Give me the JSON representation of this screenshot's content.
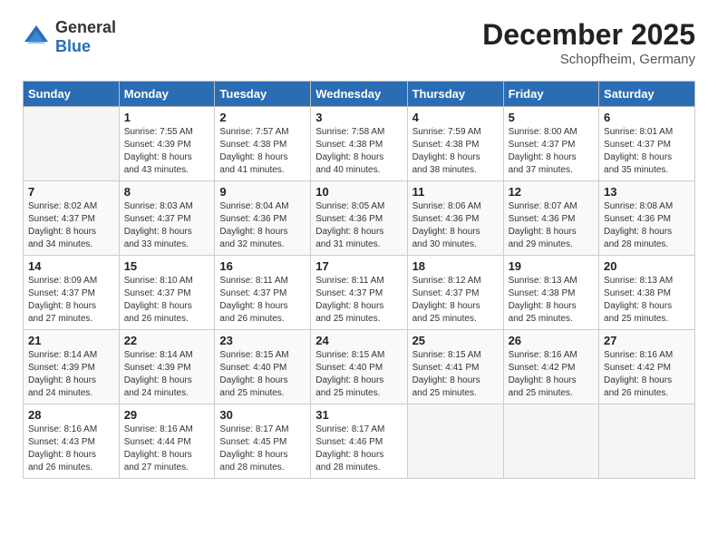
{
  "header": {
    "logo_general": "General",
    "logo_blue": "Blue",
    "month_title": "December 2025",
    "subtitle": "Schopfheim, Germany"
  },
  "days_of_week": [
    "Sunday",
    "Monday",
    "Tuesday",
    "Wednesday",
    "Thursday",
    "Friday",
    "Saturday"
  ],
  "weeks": [
    [
      {
        "day": "",
        "info": ""
      },
      {
        "day": "1",
        "info": "Sunrise: 7:55 AM\nSunset: 4:39 PM\nDaylight: 8 hours\nand 43 minutes."
      },
      {
        "day": "2",
        "info": "Sunrise: 7:57 AM\nSunset: 4:38 PM\nDaylight: 8 hours\nand 41 minutes."
      },
      {
        "day": "3",
        "info": "Sunrise: 7:58 AM\nSunset: 4:38 PM\nDaylight: 8 hours\nand 40 minutes."
      },
      {
        "day": "4",
        "info": "Sunrise: 7:59 AM\nSunset: 4:38 PM\nDaylight: 8 hours\nand 38 minutes."
      },
      {
        "day": "5",
        "info": "Sunrise: 8:00 AM\nSunset: 4:37 PM\nDaylight: 8 hours\nand 37 minutes."
      },
      {
        "day": "6",
        "info": "Sunrise: 8:01 AM\nSunset: 4:37 PM\nDaylight: 8 hours\nand 35 minutes."
      }
    ],
    [
      {
        "day": "7",
        "info": "Sunrise: 8:02 AM\nSunset: 4:37 PM\nDaylight: 8 hours\nand 34 minutes."
      },
      {
        "day": "8",
        "info": "Sunrise: 8:03 AM\nSunset: 4:37 PM\nDaylight: 8 hours\nand 33 minutes."
      },
      {
        "day": "9",
        "info": "Sunrise: 8:04 AM\nSunset: 4:36 PM\nDaylight: 8 hours\nand 32 minutes."
      },
      {
        "day": "10",
        "info": "Sunrise: 8:05 AM\nSunset: 4:36 PM\nDaylight: 8 hours\nand 31 minutes."
      },
      {
        "day": "11",
        "info": "Sunrise: 8:06 AM\nSunset: 4:36 PM\nDaylight: 8 hours\nand 30 minutes."
      },
      {
        "day": "12",
        "info": "Sunrise: 8:07 AM\nSunset: 4:36 PM\nDaylight: 8 hours\nand 29 minutes."
      },
      {
        "day": "13",
        "info": "Sunrise: 8:08 AM\nSunset: 4:36 PM\nDaylight: 8 hours\nand 28 minutes."
      }
    ],
    [
      {
        "day": "14",
        "info": "Sunrise: 8:09 AM\nSunset: 4:37 PM\nDaylight: 8 hours\nand 27 minutes."
      },
      {
        "day": "15",
        "info": "Sunrise: 8:10 AM\nSunset: 4:37 PM\nDaylight: 8 hours\nand 26 minutes."
      },
      {
        "day": "16",
        "info": "Sunrise: 8:11 AM\nSunset: 4:37 PM\nDaylight: 8 hours\nand 26 minutes."
      },
      {
        "day": "17",
        "info": "Sunrise: 8:11 AM\nSunset: 4:37 PM\nDaylight: 8 hours\nand 25 minutes."
      },
      {
        "day": "18",
        "info": "Sunrise: 8:12 AM\nSunset: 4:37 PM\nDaylight: 8 hours\nand 25 minutes."
      },
      {
        "day": "19",
        "info": "Sunrise: 8:13 AM\nSunset: 4:38 PM\nDaylight: 8 hours\nand 25 minutes."
      },
      {
        "day": "20",
        "info": "Sunrise: 8:13 AM\nSunset: 4:38 PM\nDaylight: 8 hours\nand 25 minutes."
      }
    ],
    [
      {
        "day": "21",
        "info": "Sunrise: 8:14 AM\nSunset: 4:39 PM\nDaylight: 8 hours\nand 24 minutes."
      },
      {
        "day": "22",
        "info": "Sunrise: 8:14 AM\nSunset: 4:39 PM\nDaylight: 8 hours\nand 24 minutes."
      },
      {
        "day": "23",
        "info": "Sunrise: 8:15 AM\nSunset: 4:40 PM\nDaylight: 8 hours\nand 25 minutes."
      },
      {
        "day": "24",
        "info": "Sunrise: 8:15 AM\nSunset: 4:40 PM\nDaylight: 8 hours\nand 25 minutes."
      },
      {
        "day": "25",
        "info": "Sunrise: 8:15 AM\nSunset: 4:41 PM\nDaylight: 8 hours\nand 25 minutes."
      },
      {
        "day": "26",
        "info": "Sunrise: 8:16 AM\nSunset: 4:42 PM\nDaylight: 8 hours\nand 25 minutes."
      },
      {
        "day": "27",
        "info": "Sunrise: 8:16 AM\nSunset: 4:42 PM\nDaylight: 8 hours\nand 26 minutes."
      }
    ],
    [
      {
        "day": "28",
        "info": "Sunrise: 8:16 AM\nSunset: 4:43 PM\nDaylight: 8 hours\nand 26 minutes."
      },
      {
        "day": "29",
        "info": "Sunrise: 8:16 AM\nSunset: 4:44 PM\nDaylight: 8 hours\nand 27 minutes."
      },
      {
        "day": "30",
        "info": "Sunrise: 8:17 AM\nSunset: 4:45 PM\nDaylight: 8 hours\nand 28 minutes."
      },
      {
        "day": "31",
        "info": "Sunrise: 8:17 AM\nSunset: 4:46 PM\nDaylight: 8 hours\nand 28 minutes."
      },
      {
        "day": "",
        "info": ""
      },
      {
        "day": "",
        "info": ""
      },
      {
        "day": "",
        "info": ""
      }
    ]
  ]
}
